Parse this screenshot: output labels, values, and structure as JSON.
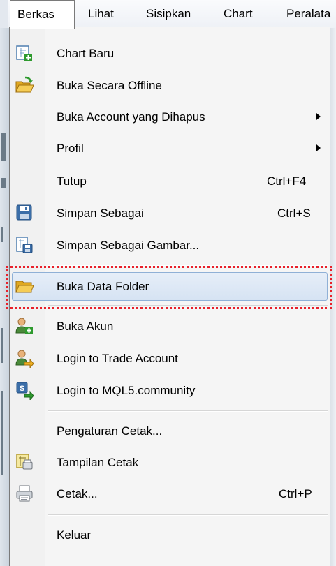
{
  "menubar": {
    "items": [
      {
        "label": "Berkas",
        "active": true
      },
      {
        "label": "Lihat"
      },
      {
        "label": "Sisipkan"
      },
      {
        "label": "Chart"
      },
      {
        "label": "Peralata"
      }
    ]
  },
  "menu": {
    "items": [
      {
        "label": "Chart Baru",
        "icon": "new-chart-icon"
      },
      {
        "label": "Buka Secara Offline",
        "icon": "open-folder-arrow-icon"
      },
      {
        "label": "Buka Account yang Dihapus",
        "submenu": true
      },
      {
        "label": "Profil",
        "submenu": true
      },
      {
        "label": "Tutup",
        "shortcut": "Ctrl+F4"
      },
      {
        "label": "Simpan Sebagai",
        "shortcut": "Ctrl+S",
        "icon": "floppy-disk-icon"
      },
      {
        "label": "Simpan Sebagai Gambar...",
        "icon": "save-picture-icon"
      },
      {
        "label": "Buka Data Folder",
        "icon": "folder-icon",
        "highlighted": true
      },
      {
        "label": "Buka Akun",
        "icon": "user-add-icon"
      },
      {
        "label": "Login to Trade Account",
        "icon": "user-login-icon"
      },
      {
        "label": "Login to MQL5.community",
        "icon": "mql5-login-icon"
      },
      {
        "label": "Pengaturan Cetak...",
        "icon": "none"
      },
      {
        "label": "Tampilan Cetak",
        "icon": "print-preview-icon"
      },
      {
        "label": "Cetak...",
        "shortcut": "Ctrl+P",
        "icon": "printer-icon"
      },
      {
        "label": "Keluar"
      }
    ]
  },
  "colors": {
    "highlight_border": "#8fb0d6",
    "highlight_fill": "#dce8f6",
    "annotation_red": "#e8202a"
  }
}
